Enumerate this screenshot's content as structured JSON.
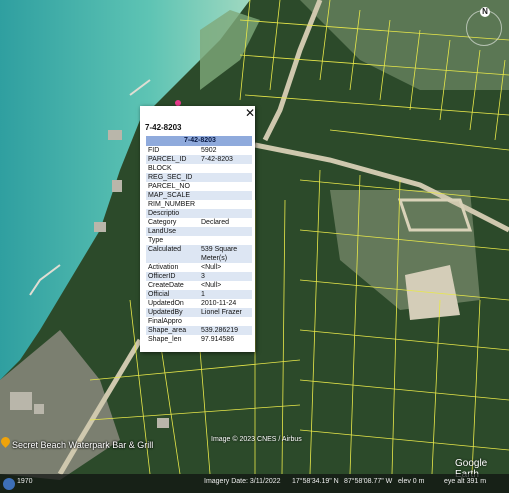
{
  "popup": {
    "title": "7-42-8203",
    "header": "7-42-8203",
    "close_glyph": "✕",
    "rows": [
      {
        "key": "FID",
        "value": "5902"
      },
      {
        "key": "PARCEL_ID",
        "value": "7-42-8203"
      },
      {
        "key": "BLOCK",
        "value": ""
      },
      {
        "key": "REG_SEC_ID",
        "value": ""
      },
      {
        "key": "PARCEL_NO",
        "value": ""
      },
      {
        "key": "MAP_SCALE",
        "value": ""
      },
      {
        "key": "RIM_NUMBER",
        "value": ""
      },
      {
        "key": "Descriptio",
        "value": ""
      },
      {
        "key": "Category",
        "value": "Declared"
      },
      {
        "key": "LandUse",
        "value": ""
      },
      {
        "key": "Type",
        "value": ""
      },
      {
        "key": "Calculated",
        "value": "539 Square Meter(s)"
      },
      {
        "key": "Activation",
        "value": "<Null>"
      },
      {
        "key": "OfficerID",
        "value": "3"
      },
      {
        "key": "CreateDate",
        "value": "<Null>"
      },
      {
        "key": "Official",
        "value": "1"
      },
      {
        "key": "UpdatedOn",
        "value": "2010-11-24"
      },
      {
        "key": "UpdatedBy",
        "value": "Lionel Frazer"
      },
      {
        "key": "FinalAppro",
        "value": ""
      },
      {
        "key": "Shape_area",
        "value": "539.286219"
      },
      {
        "key": "Shape_len",
        "value": "97.914586"
      }
    ]
  },
  "map": {
    "poi_label": "Secret Beach Waterpark Bar & Grill",
    "copyright": "Image © 2023 CNES / Airbus",
    "logo": "Google Earth",
    "compass_label": "N"
  },
  "status": {
    "scale_label": "1970",
    "imagery_date": "Imagery Date: 3/11/2022",
    "lat": "17°58'34.19\" N",
    "lon": "87°58'08.77\" W",
    "elev": "elev   0 m",
    "eye_alt": "eye alt   391 m"
  },
  "colors": {
    "parcel_line": "#e8e84a",
    "sea": "#3fb0a8",
    "header_row": "#8faadc",
    "alt_row": "#dde6f3"
  }
}
